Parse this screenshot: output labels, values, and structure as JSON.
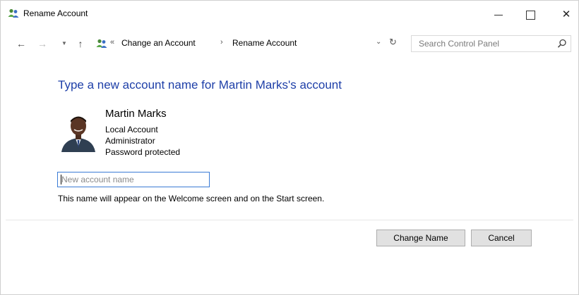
{
  "window": {
    "title": "Rename Account",
    "app_icon": "user-accounts-icon",
    "minimize_icon": "minimize-icon",
    "maximize_icon": "maximize-icon",
    "close_icon": "close-icon"
  },
  "navigation": {
    "back_icon": "back-arrow-icon",
    "forward_icon": "forward-arrow-icon",
    "recent_icon": "recent-locations-icon",
    "up_icon": "up-arrow-icon",
    "address": {
      "overflow": "«",
      "breadcrumbs": [
        "Change an Account",
        "Rename Account"
      ],
      "separator": "›",
      "dropdown_icon": "chevron-down-icon",
      "refresh_icon": "refresh-icon"
    },
    "search": {
      "placeholder": "Search Control Panel",
      "icon": "search-icon"
    }
  },
  "main": {
    "heading": "Type a new account name for Martin Marks's account",
    "user": {
      "name": "Martin Marks",
      "details": [
        "Local Account",
        "Administrator",
        "Password protected"
      ],
      "avatar": "user-photo"
    },
    "input": {
      "placeholder": "New account name",
      "value": ""
    },
    "hint": "This name will appear on the Welcome screen and on the Start screen."
  },
  "buttons": {
    "change_name": "Change Name",
    "cancel": "Cancel"
  },
  "colors": {
    "heading": "#1e3fa8",
    "input_border": "#3a7bd5",
    "button_face": "#e1e1e1",
    "button_border": "#adadad"
  }
}
